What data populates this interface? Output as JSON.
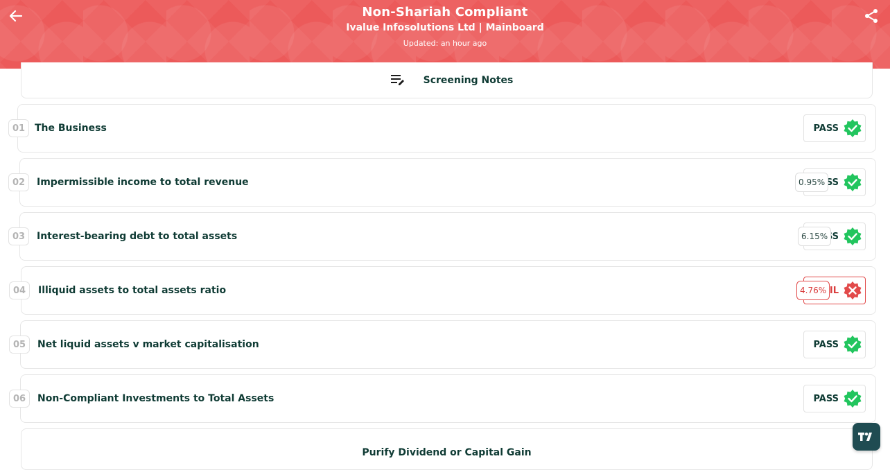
{
  "header": {
    "title": "Non-Shariah Compliant",
    "subtitle": "Ivalue Infosolutions Ltd | Mainboard",
    "updated": "Updated: an hour ago"
  },
  "notes": {
    "label": "Screening Notes"
  },
  "rows": [
    {
      "num": "01",
      "label": "The Business",
      "status": "PASS"
    },
    {
      "num": "02",
      "label": "Impermissible income to total revenue",
      "status": "PASS",
      "pct": "0.95%"
    },
    {
      "num": "03",
      "label": "Interest-bearing debt to total assets",
      "status": "PASS",
      "pct": "6.15%"
    },
    {
      "num": "04",
      "label": "Illiquid assets to total assets ratio",
      "status": "FAIL",
      "pct": "4.76%"
    },
    {
      "num": "05",
      "label": "Net liquid assets v market capitalisation",
      "status": "PASS"
    },
    {
      "num": "06",
      "label": "Non-Compliant Investments to Total Assets",
      "status": "PASS"
    }
  ],
  "purify": {
    "label": "Purify Dividend or Capital Gain"
  },
  "colors": {
    "header_bg": "#ec5a5a",
    "pass_green": "#22c55e",
    "fail_red": "#e24a4a",
    "text_dark": "#0f3b34"
  },
  "icons": {
    "back": "arrow-left-icon",
    "share": "share-icon",
    "notes": "notes-edit-icon",
    "pass": "verified-check-icon",
    "fail": "fail-x-badge-icon",
    "badge": "tradingview-logo-icon"
  }
}
